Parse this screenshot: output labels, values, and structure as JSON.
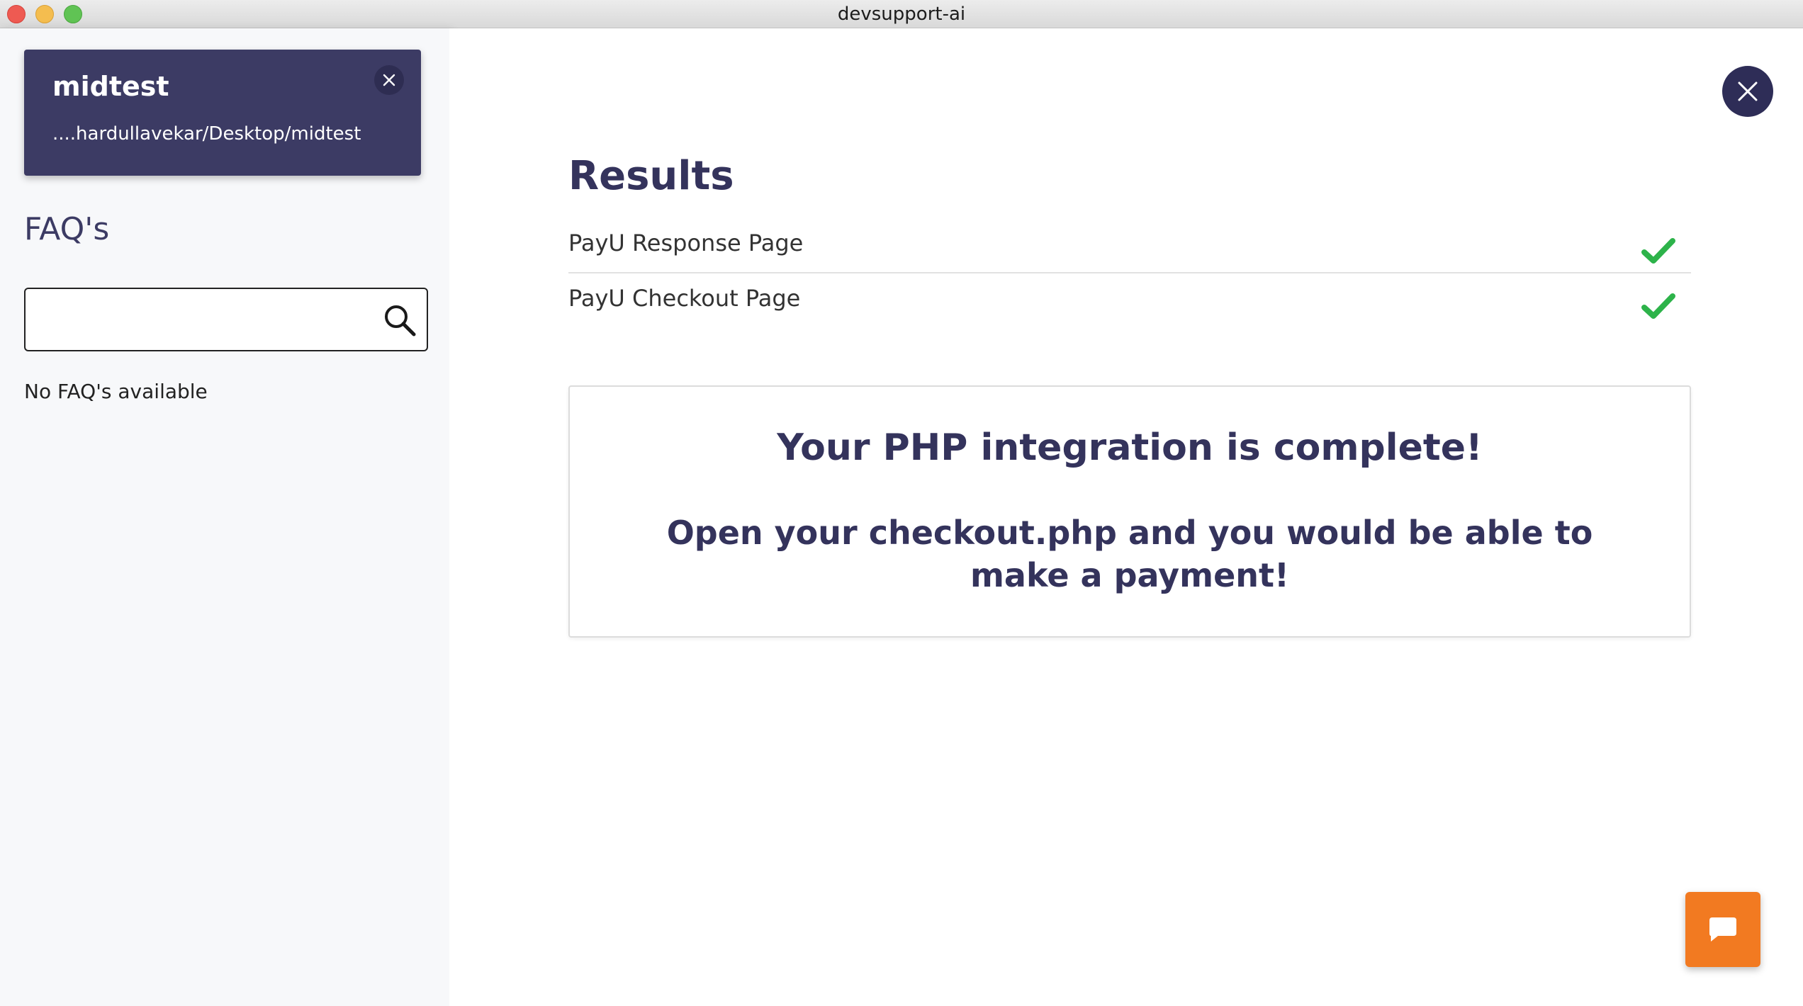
{
  "window": {
    "title": "devsupport-ai"
  },
  "sidebar": {
    "project": {
      "name": "midtest",
      "path": "....hardullavekar/Desktop/midtest",
      "close_icon": "close-icon"
    },
    "faq": {
      "title": "FAQ's",
      "search_value": "",
      "search_placeholder": "",
      "search_icon": "search-icon",
      "empty_message": "No FAQ's available"
    }
  },
  "main": {
    "close_icon": "close-icon",
    "results_title": "Results",
    "results": [
      {
        "label": "PayU Response Page",
        "status": "passed",
        "status_icon": "check-icon"
      },
      {
        "label": "PayU Checkout Page",
        "status": "passed",
        "status_icon": "check-icon"
      }
    ],
    "success": {
      "heading": "Your PHP integration is complete!",
      "message": "Open your checkout.php and you would be able to make a payment!"
    },
    "chat_icon": "chat-bubble-icon"
  },
  "colors": {
    "brand_dark": "#3c3b64",
    "success_green": "#2db34a",
    "chat_orange": "#f27a21"
  }
}
